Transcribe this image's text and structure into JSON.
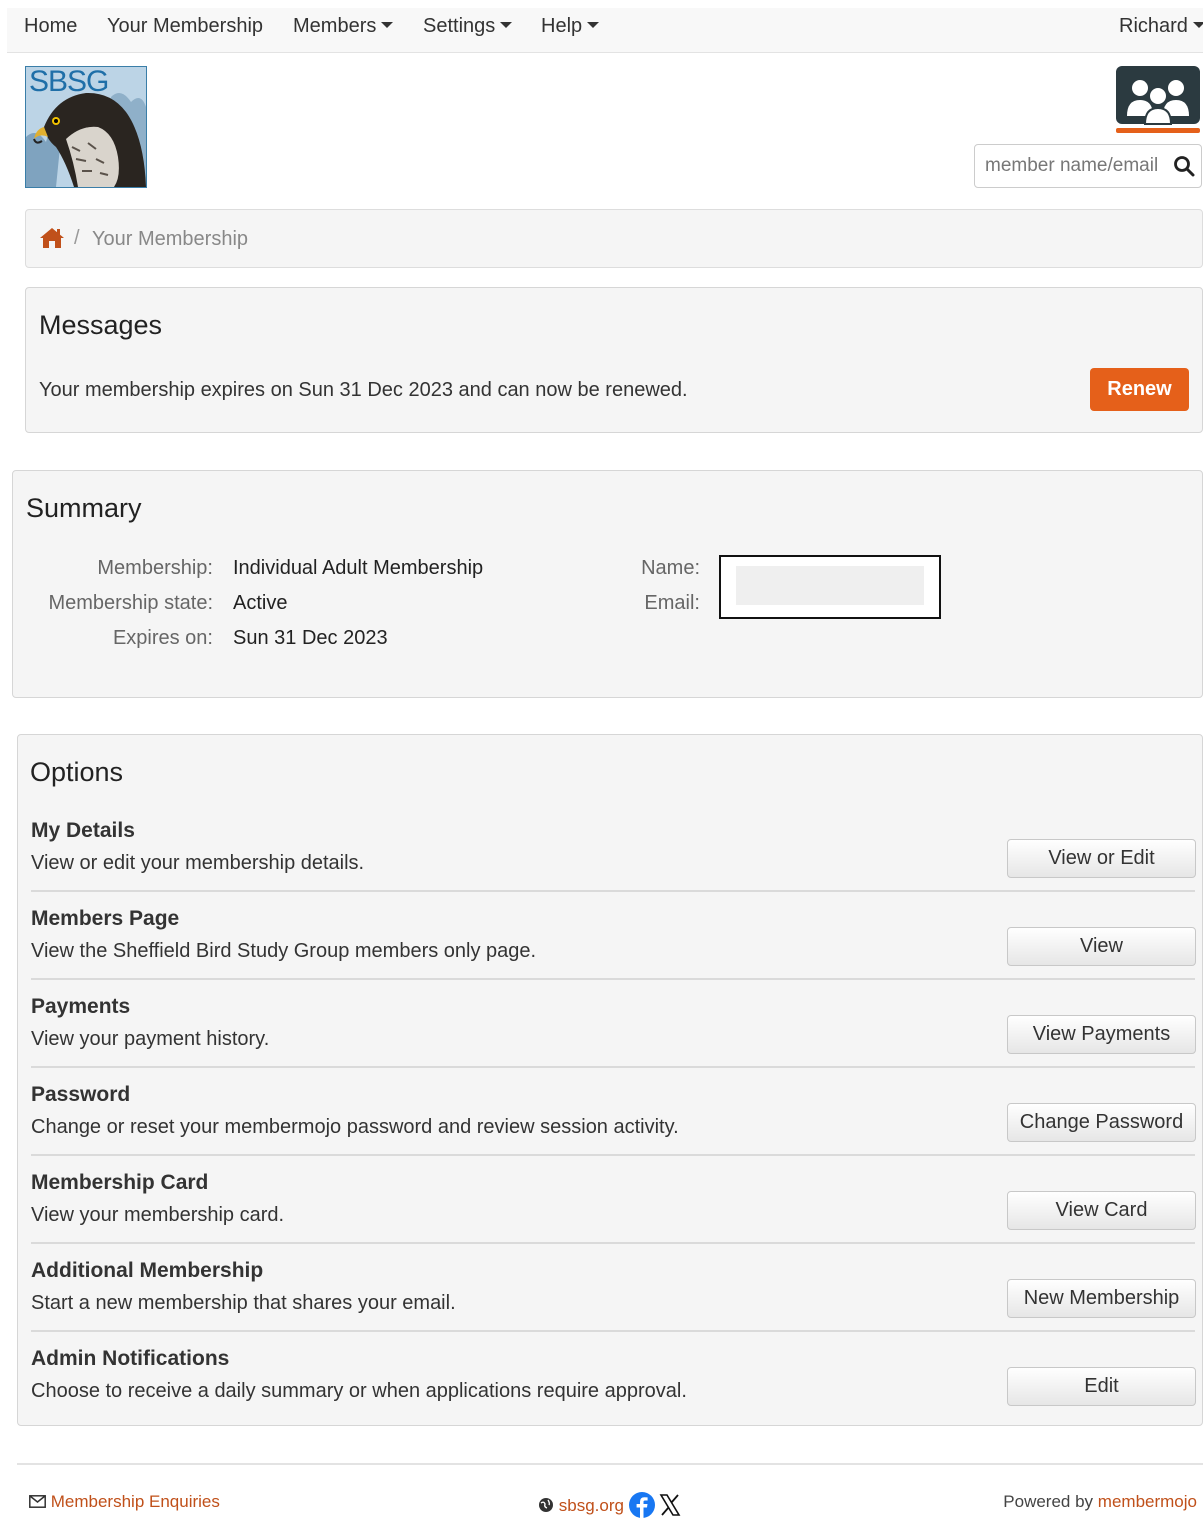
{
  "nav": {
    "home": "Home",
    "your_membership": "Your Membership",
    "members": "Members",
    "settings": "Settings",
    "help": "Help",
    "user": "Richard"
  },
  "logo": {
    "text": "SBSG"
  },
  "search": {
    "placeholder": "member name/email"
  },
  "breadcrumb": {
    "current": "Your Membership",
    "separator": "/"
  },
  "messages": {
    "title": "Messages",
    "text": "Your membership expires on Sun 31 Dec 2023 and can now be renewed.",
    "renew_label": "Renew"
  },
  "summary": {
    "title": "Summary",
    "membership_label": "Membership:",
    "membership_value": "Individual Adult Membership",
    "state_label": "Membership state:",
    "state_value": "Active",
    "expires_label": "Expires on:",
    "expires_value": "Sun 31 Dec 2023",
    "name_label": "Name:",
    "email_label": "Email:"
  },
  "options": {
    "title": "Options",
    "items": [
      {
        "title": "My Details",
        "desc": "View or edit your membership details.",
        "button": "View or Edit"
      },
      {
        "title": "Members Page",
        "desc": "View the Sheffield Bird Study Group members only page.",
        "button": "View"
      },
      {
        "title": "Payments",
        "desc": "View your payment history.",
        "button": "View Payments"
      },
      {
        "title": "Password",
        "desc": "Change or reset your membermojo password and review session activity.",
        "button": "Change Password"
      },
      {
        "title": "Membership Card",
        "desc": "View your membership card.",
        "button": "View Card"
      },
      {
        "title": "Additional Membership",
        "desc": "Start a new membership that shares your email.",
        "button": "New Membership"
      },
      {
        "title": "Admin Notifications",
        "desc": "Choose to receive a daily summary or when applications require approval.",
        "button": "Edit"
      }
    ]
  },
  "footer": {
    "enquiries": "Membership Enquiries",
    "site": "sbsg.org",
    "powered_by": "Powered by",
    "brand": "membermojo"
  },
  "colors": {
    "accent": "#e5601a",
    "link": "#c0501a",
    "panel_bg": "#f5f5f5"
  }
}
